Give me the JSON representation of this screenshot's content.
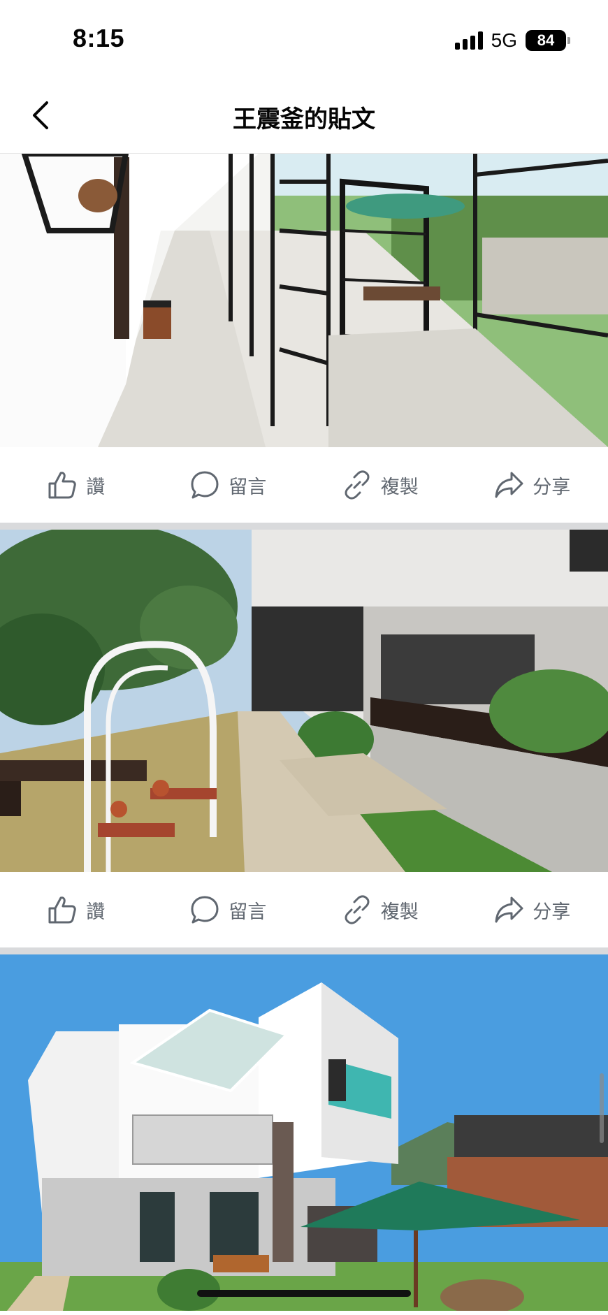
{
  "status_bar": {
    "time": "8:15",
    "network": "5G",
    "battery": "84"
  },
  "header": {
    "title": "王震釜的貼文"
  },
  "posts": [
    {
      "image_alt": "corridor",
      "actions": {
        "like": "讚",
        "comment": "留言",
        "copy": "複製",
        "share": "分享"
      }
    },
    {
      "image_alt": "garden",
      "actions": {
        "like": "讚",
        "comment": "留言",
        "copy": "複製",
        "share": "分享"
      }
    },
    {
      "image_alt": "villa"
    }
  ],
  "icons": [
    "back-chevron-icon",
    "like-icon",
    "comment-icon",
    "link-icon",
    "share-icon"
  ],
  "colors": {
    "action_text": "#606770",
    "divider": "#d9dadc",
    "sky": "#4a9de0",
    "umbrella": "#1f7a5a"
  }
}
